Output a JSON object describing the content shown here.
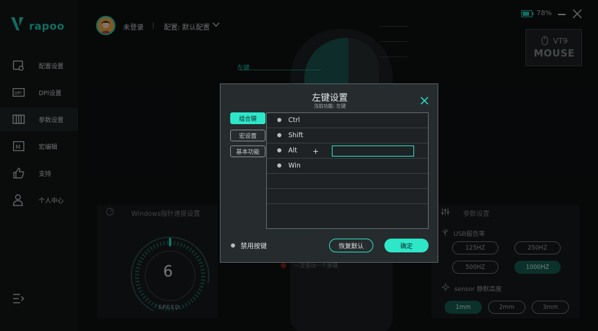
{
  "brand": {
    "logo_text": "rapoo"
  },
  "sidebar": {
    "items": [
      {
        "label": "配置设置",
        "icon": "config-icon"
      },
      {
        "label": "DPI设置",
        "icon": "dpi-icon"
      },
      {
        "label": "参数设置",
        "icon": "params-icon",
        "active": true
      },
      {
        "label": "宏编辑",
        "icon": "macro-icon"
      },
      {
        "label": "支持",
        "icon": "thumbs-up-icon"
      },
      {
        "label": "个人中心",
        "icon": "user-icon"
      }
    ],
    "menu_icon": "menu-icon"
  },
  "topbar": {
    "login_text": "未登录",
    "profile_text": "配置: 默认配置",
    "battery_text": "78%",
    "battery_level": 0.78
  },
  "device": {
    "model_name": "VT9",
    "model_series": "MOUSE",
    "left_key_label": "左键"
  },
  "background_panels": {
    "pointer_speed_title": "Windows指针速度设置",
    "pointer_speed_value": "6",
    "pointer_speed_label": "SPEED",
    "params_title": "参数设置",
    "usb_title": "USB报告率",
    "usb_options": [
      "125HZ",
      "250HZ",
      "500HZ",
      "1000HZ"
    ],
    "usb_selected": "1000HZ",
    "sensor_title": "sensor 静默高度",
    "sensor_options": [
      "1mm",
      "2mm",
      "3mm"
    ],
    "sensor_selected": "1mm",
    "scroll_text": "一次滚动一个屏幕"
  },
  "dialog": {
    "title": "左键设置",
    "subtitle": "当前功能: 左键",
    "tabs": [
      {
        "label": "组合键",
        "active": true
      },
      {
        "label": "宏设置",
        "active": false
      },
      {
        "label": "基本功能",
        "active": false
      }
    ],
    "modifiers": [
      "Ctrl",
      "Shift",
      "Alt",
      "Win"
    ],
    "plus": "+",
    "key_input_value": "",
    "disable_label": "禁用按键",
    "reset_label": "恢复默认",
    "ok_label": "确定"
  },
  "colors": {
    "accent": "#2ee6c8",
    "accent_dark": "#1fc7b0",
    "background": "#0d0f10",
    "sidebar_bg": "#131617",
    "dialog_bg": "#282d2f"
  }
}
